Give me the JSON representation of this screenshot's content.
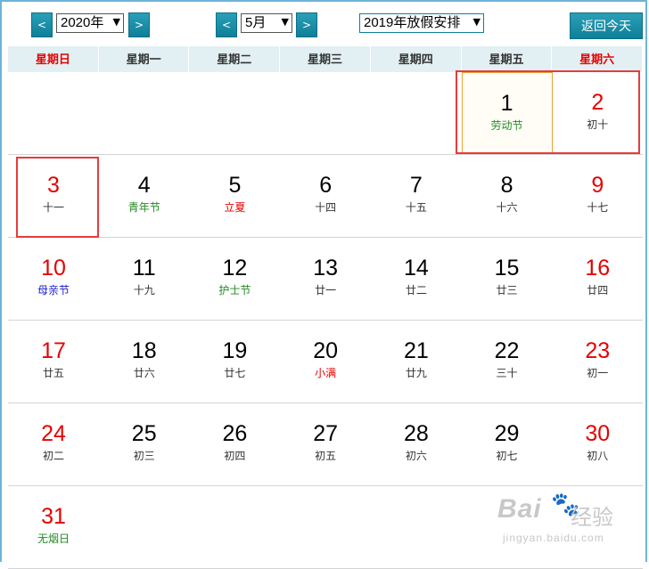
{
  "toolbar": {
    "prev_year": "<",
    "year_value": "2020年",
    "next_year": ">",
    "prev_month": "<",
    "month_value": "5月",
    "next_month": ">",
    "holiday_value": "2019年放假安排",
    "today_label": "返回今天",
    "dropdown_arrow": "▼"
  },
  "weekdays": [
    "星期日",
    "星期一",
    "星期二",
    "星期三",
    "星期四",
    "星期五",
    "星期六"
  ],
  "weeks": [
    [
      {
        "day": "",
        "sub": ""
      },
      {
        "day": "",
        "sub": ""
      },
      {
        "day": "",
        "sub": ""
      },
      {
        "day": "",
        "sub": ""
      },
      {
        "day": "",
        "sub": ""
      },
      {
        "day": "1",
        "sub": "劳动节",
        "sub_style": "green",
        "selected": true
      },
      {
        "day": "2",
        "sub": "初十"
      }
    ],
    [
      {
        "day": "3",
        "sub": "十一"
      },
      {
        "day": "4",
        "sub": "青年节",
        "sub_style": "green"
      },
      {
        "day": "5",
        "sub": "立夏",
        "sub_style": "red"
      },
      {
        "day": "6",
        "sub": "十四"
      },
      {
        "day": "7",
        "sub": "十五"
      },
      {
        "day": "8",
        "sub": "十六"
      },
      {
        "day": "9",
        "sub": "十七"
      }
    ],
    [
      {
        "day": "10",
        "sub": "母亲节",
        "sub_style": "blue"
      },
      {
        "day": "11",
        "sub": "十九"
      },
      {
        "day": "12",
        "sub": "护士节",
        "sub_style": "green"
      },
      {
        "day": "13",
        "sub": "廿一"
      },
      {
        "day": "14",
        "sub": "廿二"
      },
      {
        "day": "15",
        "sub": "廿三"
      },
      {
        "day": "16",
        "sub": "廿四"
      }
    ],
    [
      {
        "day": "17",
        "sub": "廿五"
      },
      {
        "day": "18",
        "sub": "廿六"
      },
      {
        "day": "19",
        "sub": "廿七"
      },
      {
        "day": "20",
        "sub": "小满",
        "sub_style": "red"
      },
      {
        "day": "21",
        "sub": "廿九"
      },
      {
        "day": "22",
        "sub": "三十"
      },
      {
        "day": "23",
        "sub": "初一"
      }
    ],
    [
      {
        "day": "24",
        "sub": "初二"
      },
      {
        "day": "25",
        "sub": "初三"
      },
      {
        "day": "26",
        "sub": "初四"
      },
      {
        "day": "27",
        "sub": "初五"
      },
      {
        "day": "28",
        "sub": "初六"
      },
      {
        "day": "29",
        "sub": "初七"
      },
      {
        "day": "30",
        "sub": "初八"
      }
    ],
    [
      {
        "day": "31",
        "sub": "无烟日",
        "sub_style": "green"
      },
      {
        "day": "",
        "sub": ""
      },
      {
        "day": "",
        "sub": ""
      },
      {
        "day": "",
        "sub": ""
      },
      {
        "day": "",
        "sub": ""
      },
      {
        "day": "",
        "sub": ""
      },
      {
        "day": "",
        "sub": ""
      }
    ]
  ],
  "watermark": {
    "logo": "Bai",
    "paw": "🐾",
    "cn": "经验",
    "url": "jingyan.baidu.com"
  },
  "colors": {
    "weekend_red": "#e60000",
    "button_teal": "#0f7f98",
    "header_bg": "#e2f0f3",
    "highlight_red": "#e63c3c"
  }
}
